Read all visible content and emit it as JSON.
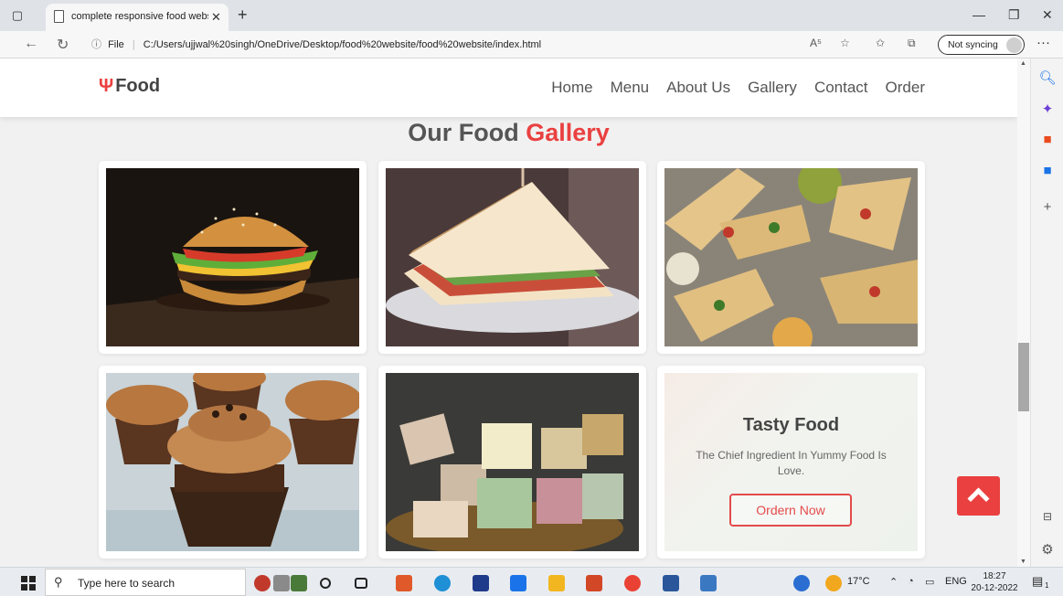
{
  "browser": {
    "tab_title": "complete responsive food websi",
    "tab_close": "✕",
    "new_tab": "+",
    "url_prefix": "File",
    "url": "C:/Users/ujjwal%20singh/OneDrive/Desktop/food%20website/food%20website/index.html",
    "read_aloud": "A⁵",
    "profile_label": "Not syncing",
    "more": "···"
  },
  "site": {
    "logo_text": "Food",
    "nav": [
      "Home",
      "Menu",
      "About Us",
      "Gallery",
      "Contact",
      "Order"
    ],
    "gallery_title_main": "Our Food",
    "gallery_title_accent": "Gallery",
    "promo": {
      "title": "Tasty Food",
      "text": "The Chief Ingredient In Yummy Food Is Love.",
      "button": "Ordern Now"
    },
    "images": [
      "burger",
      "sandwich",
      "wraps",
      "cupcakes",
      "fudge"
    ]
  },
  "taskbar": {
    "search_placeholder": "Type here to search",
    "temperature": "17°C",
    "language": "ENG",
    "time": "18:27",
    "date": "20-12-2022",
    "notification_count": "1"
  },
  "colors": {
    "accent": "#ea4040",
    "text": "#555555"
  }
}
